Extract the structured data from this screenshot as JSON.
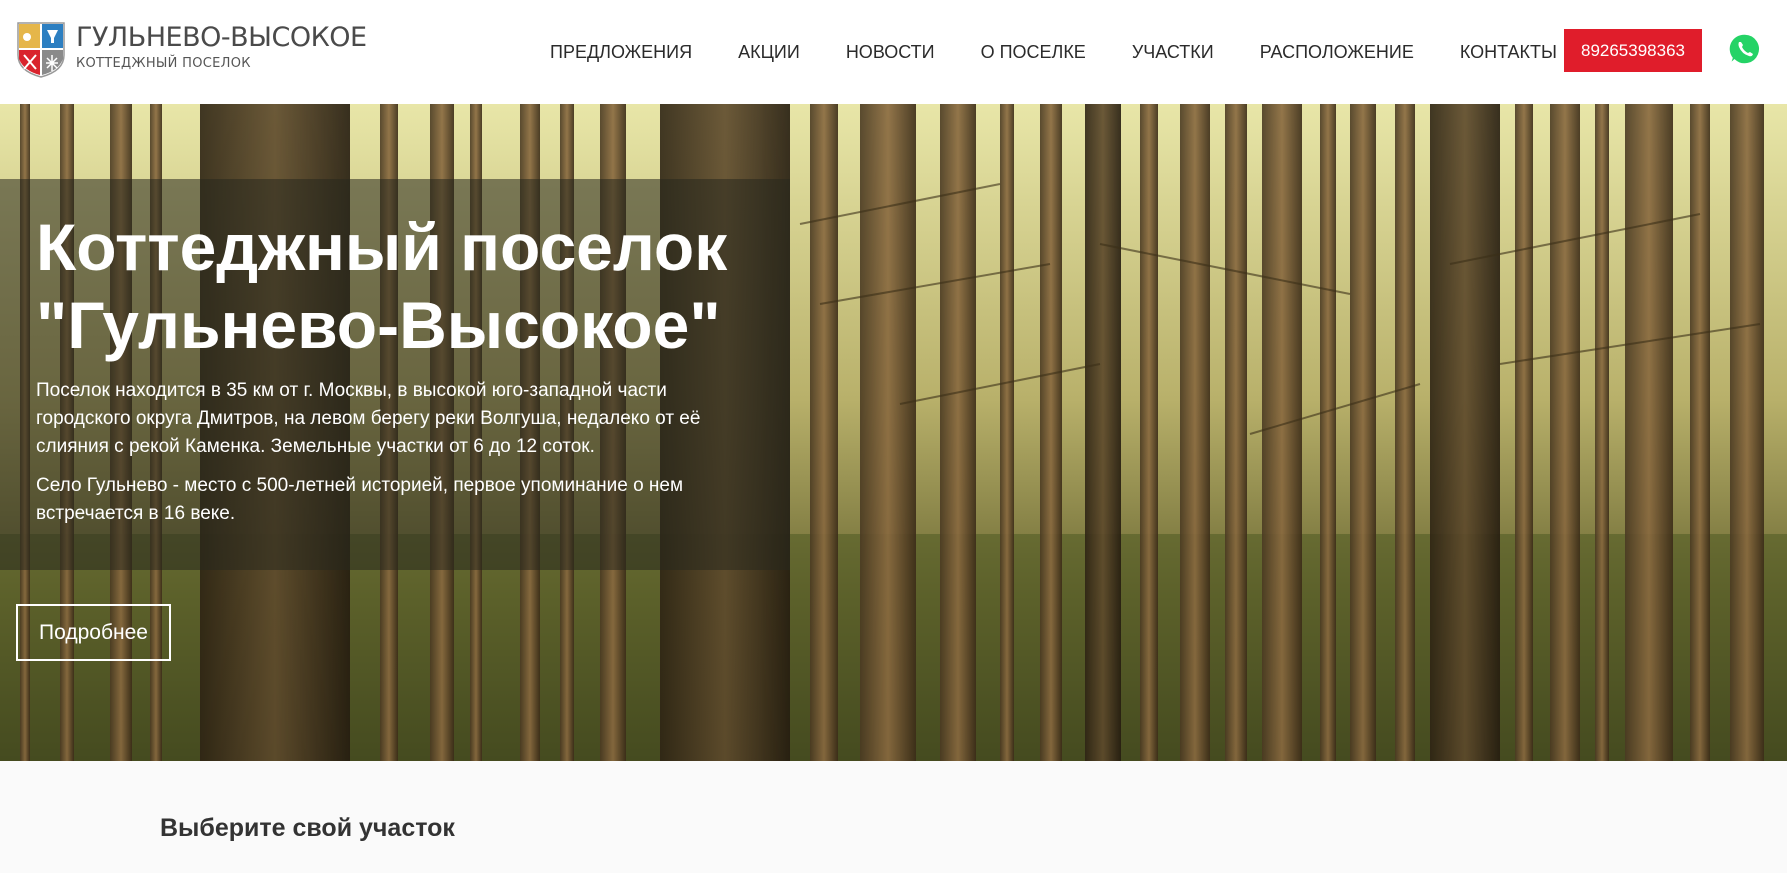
{
  "header": {
    "logo": {
      "title": "ГУЛЬНЕВО-ВЫСОКОЕ",
      "subtitle": "КОТТЕДЖНЫЙ ПОСЕЛОК"
    },
    "nav": [
      {
        "label": "ПРЕДЛОЖЕНИЯ"
      },
      {
        "label": "АКЦИИ"
      },
      {
        "label": "НОВОСТИ"
      },
      {
        "label": "О ПОСЕЛКЕ"
      },
      {
        "label": "УЧАСТКИ"
      },
      {
        "label": "РАСПОЛОЖЕНИЕ"
      },
      {
        "label": "КОНТАКТЫ"
      }
    ],
    "phone": "89265398363",
    "whatsapp_icon": "whatsapp-icon"
  },
  "hero": {
    "title": "Коттеджный поселок \"Гульнево-Высокое\"",
    "paragraph1": "Поселок находится в 35 км от г. Москвы, в высокой юго-западной части городского округа Дмитров, на левом берегу реки Волгуша, недалеко от её слияния с рекой Каменка. Земельные участки от 6 до 12 соток.",
    "paragraph2": "Село Гульнево - место с 500-летней историей, первое упоминание о нем встречается в 16 веке.",
    "button_label": "Подробнее"
  },
  "section": {
    "title": "Выберите свой участок"
  },
  "colors": {
    "accent": "#e01d2b",
    "whatsapp": "#25d366",
    "nav_text": "#2b2b2b"
  }
}
